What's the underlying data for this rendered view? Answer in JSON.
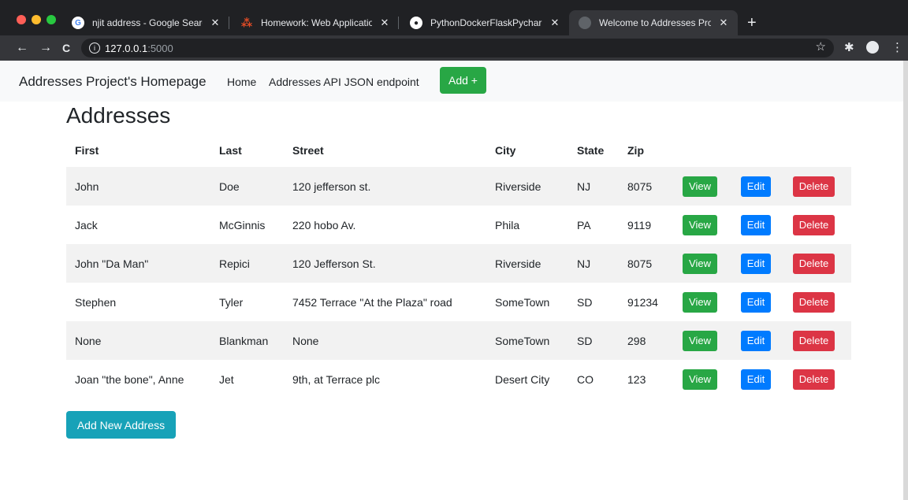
{
  "browser": {
    "tabs": [
      {
        "title": "njit address - Google Search",
        "icon": "google-icon",
        "glyph": "G",
        "active": false
      },
      {
        "title": "Homework: Web Application Pr",
        "icon": "canvas-icon",
        "glyph": "⁂",
        "active": false
      },
      {
        "title": "PythonDockerFlaskPycharm/la",
        "icon": "github-icon",
        "glyph": "●",
        "active": false
      },
      {
        "title": "Welcome to Addresses Project",
        "icon": "globe-icon",
        "glyph": "",
        "active": true
      }
    ],
    "close_glyph": "✕",
    "new_tab_glyph": "+",
    "url_host": "127.0.0.1",
    "url_port": ":5000",
    "info_glyph": "i",
    "back_glyph": "←",
    "forward_glyph": "→",
    "reload_glyph": "C",
    "star_glyph": "☆",
    "extensions_glyph": "✱",
    "menu_glyph": "⋮"
  },
  "navbar": {
    "brand": "Addresses Project's Homepage",
    "links": [
      "Home",
      "Addresses API JSON endpoint"
    ],
    "add_button": "Add +"
  },
  "main": {
    "heading": "Addresses",
    "columns": [
      "First",
      "Last",
      "Street",
      "City",
      "State",
      "Zip"
    ],
    "rows": [
      {
        "first": "John",
        "last": "Doe",
        "street": "120 jefferson st.",
        "city": "Riverside",
        "state": "NJ",
        "zip": "8075"
      },
      {
        "first": "Jack",
        "last": "McGinnis",
        "street": "220 hobo Av.",
        "city": "Phila",
        "state": "PA",
        "zip": "9119"
      },
      {
        "first": "John \"Da Man\"",
        "last": "Repici",
        "street": "120 Jefferson St.",
        "city": "Riverside",
        "state": "NJ",
        "zip": "8075"
      },
      {
        "first": "Stephen",
        "last": "Tyler",
        "street": "7452 Terrace \"At the Plaza\" road",
        "city": "SomeTown",
        "state": "SD",
        "zip": "91234"
      },
      {
        "first": "None",
        "last": "Blankman",
        "street": "None",
        "city": "SomeTown",
        "state": "SD",
        "zip": "298"
      },
      {
        "first": "Joan \"the bone\", Anne",
        "last": "Jet",
        "street": "9th, at Terrace plc",
        "city": "Desert City",
        "state": "CO",
        "zip": "123"
      }
    ],
    "row_actions": {
      "view": "View",
      "edit": "Edit",
      "delete": "Delete"
    },
    "add_new_button": "Add New Address"
  },
  "colors": {
    "success": "#28a745",
    "primary": "#007bff",
    "danger": "#dc3545",
    "info": "#17a2b8"
  }
}
